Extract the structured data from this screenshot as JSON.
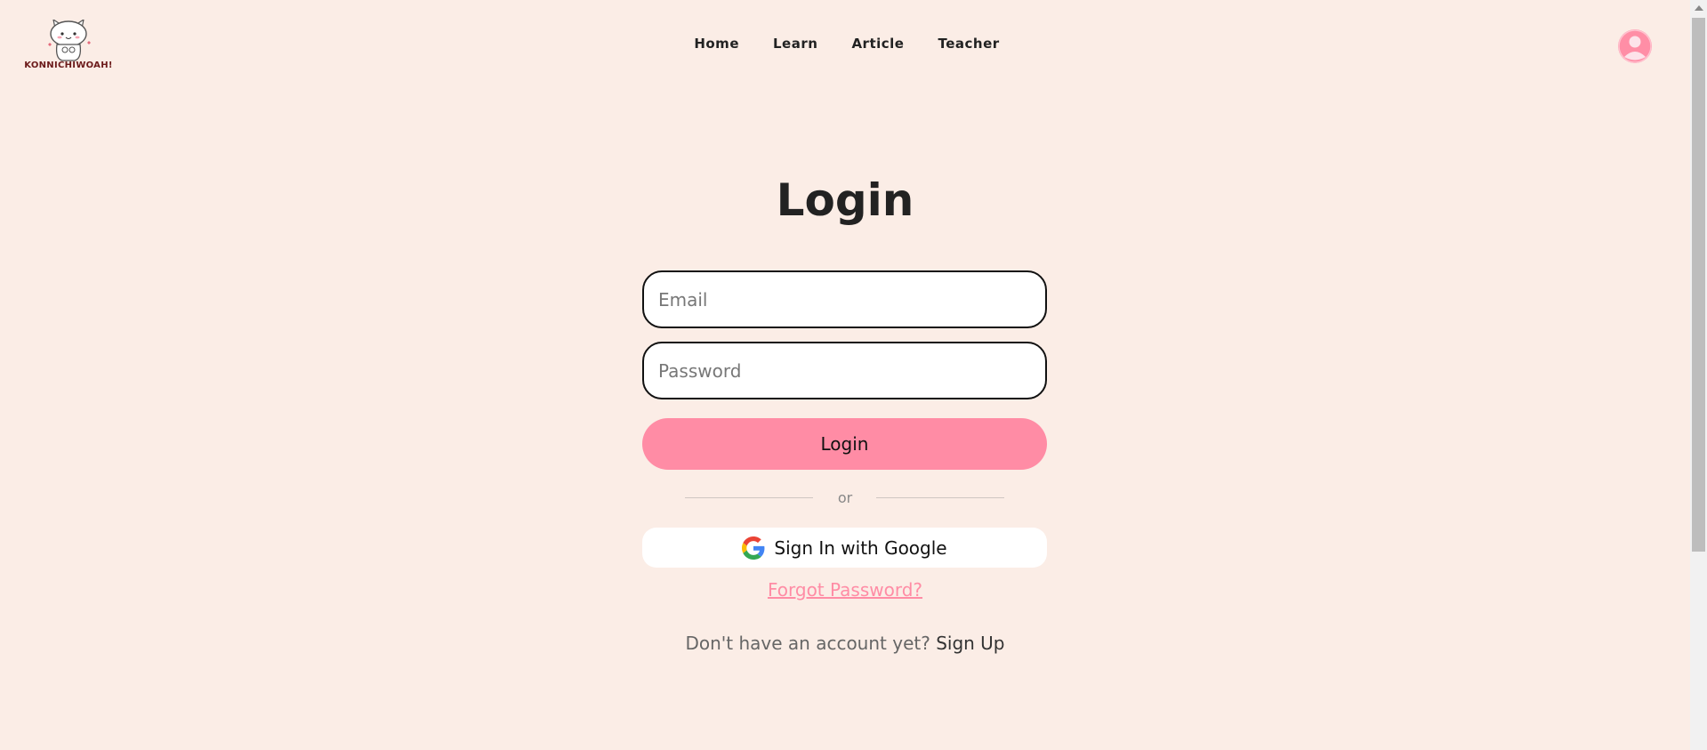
{
  "header": {
    "logo_text": "KONNICHIWOAH!",
    "nav": [
      "Home",
      "Learn",
      "Article",
      "Teacher"
    ]
  },
  "login": {
    "title": "Login",
    "email_placeholder": "Email",
    "password_placeholder": "Password",
    "login_button": "Login",
    "divider_text": "or",
    "google_button": "Sign In with Google",
    "forgot_password": "Forgot Password?",
    "signup_prompt": "Don't have an account yet?",
    "signup_link": "Sign Up"
  },
  "colors": {
    "background": "#fbede6",
    "accent": "#ff8ca5",
    "text": "#222222"
  }
}
